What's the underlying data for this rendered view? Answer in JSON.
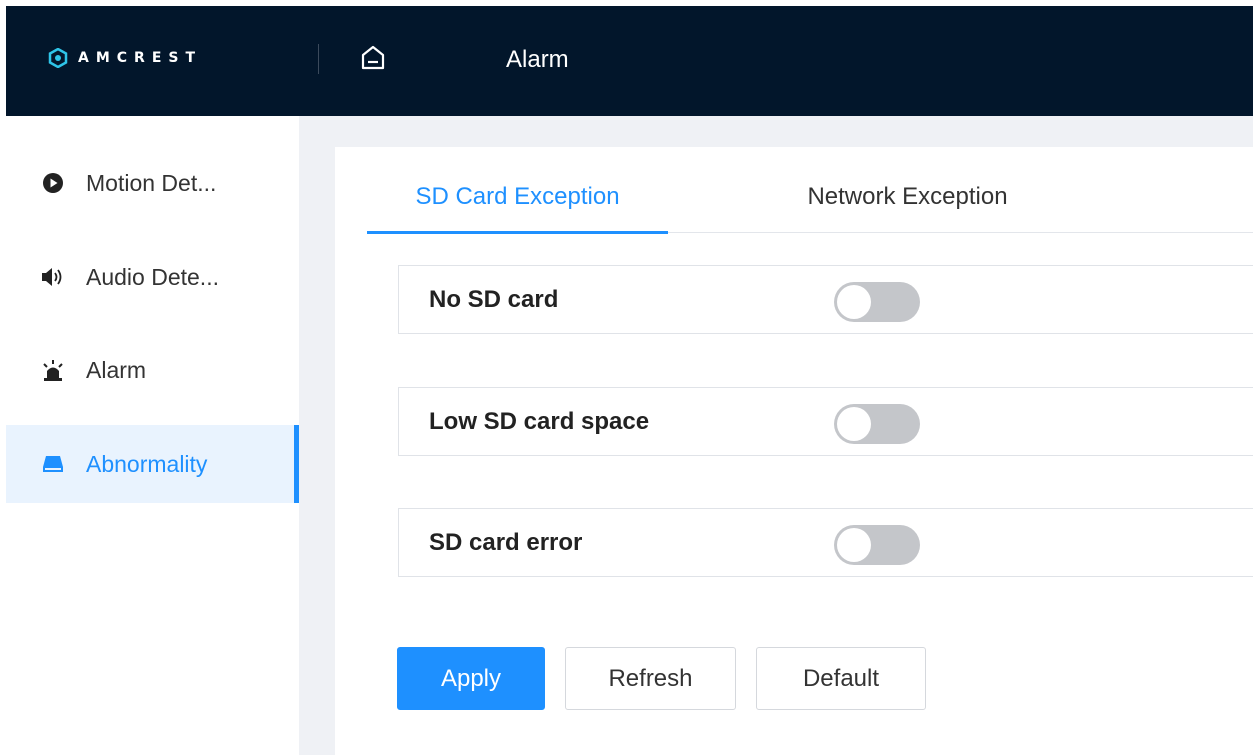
{
  "header": {
    "brand": "AMCREST",
    "title": "Alarm",
    "background_color": "#02162b"
  },
  "sidebar": {
    "items": [
      {
        "label": "Motion Det...",
        "icon": "play-circle-icon",
        "active": false
      },
      {
        "label": "Audio Dete...",
        "icon": "speaker-icon",
        "active": false
      },
      {
        "label": "Alarm",
        "icon": "siren-icon",
        "active": false
      },
      {
        "label": "Abnormality",
        "icon": "drive-icon",
        "active": true
      }
    ]
  },
  "tabs": [
    {
      "label": "SD Card Exception",
      "active": true
    },
    {
      "label": "Network Exception",
      "active": false
    }
  ],
  "settings": [
    {
      "label": "No SD card",
      "enabled": false
    },
    {
      "label": "Low SD card space",
      "enabled": false
    },
    {
      "label": "SD card error",
      "enabled": false
    }
  ],
  "actions": {
    "apply": "Apply",
    "refresh": "Refresh",
    "default": "Default"
  },
  "colors": {
    "accent": "#1e90ff",
    "toggle_off": "#c4c6ca",
    "content_bg": "#eff1f5"
  }
}
